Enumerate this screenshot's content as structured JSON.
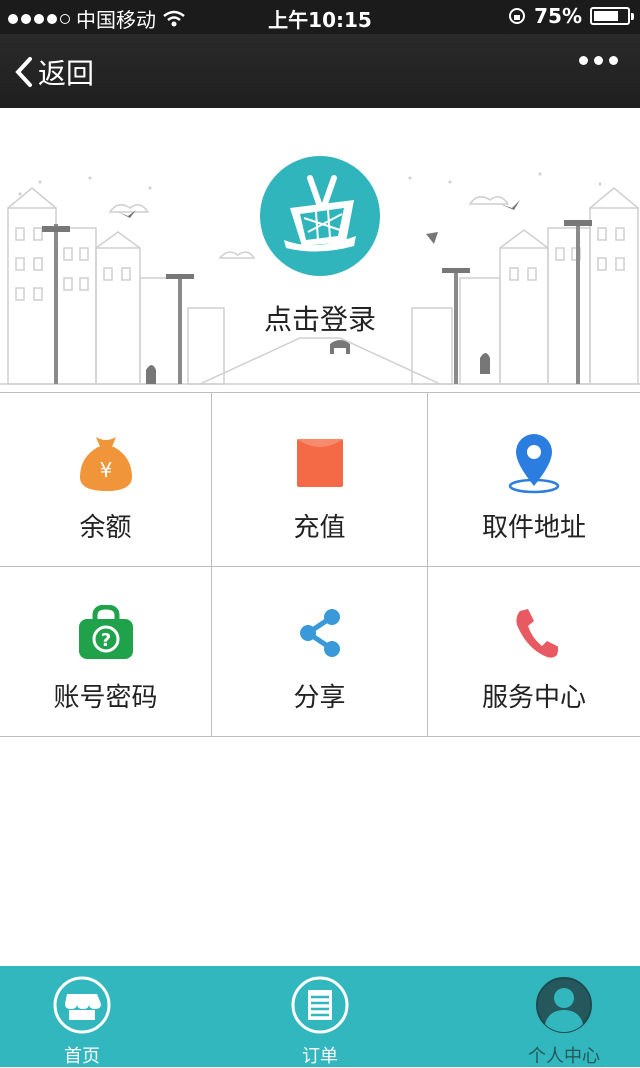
{
  "status_bar": {
    "carrier": "中国移动",
    "time": "上午10:15",
    "battery": "75%",
    "battery_level": 0.75
  },
  "nav": {
    "back_label": "返回",
    "more_icon": "more-dots-icon"
  },
  "banner": {
    "login_text": "点击登录",
    "avatar_icon": "shopping-basket-icon",
    "avatar_color": "#31b5bd"
  },
  "grid": [
    {
      "label": "余额",
      "icon": "money-bag-icon",
      "color": "#f0953a"
    },
    {
      "label": "充值",
      "icon": "red-envelope-icon",
      "color": "#f46a46"
    },
    {
      "label": "取件地址",
      "icon": "location-pin-icon",
      "color": "#2b7ee0"
    },
    {
      "label": "账号密码",
      "icon": "lock-bag-icon",
      "color": "#20a24a"
    },
    {
      "label": "分享",
      "icon": "share-icon",
      "color": "#3a9ad9"
    },
    {
      "label": "服务中心",
      "icon": "phone-icon",
      "color": "#e85a62"
    }
  ],
  "tabbar": {
    "background": "#33b7be",
    "items": [
      {
        "label": "首页",
        "icon": "store-icon"
      },
      {
        "label": "订单",
        "icon": "order-list-icon"
      },
      {
        "label": "个人中心",
        "icon": "user-icon"
      }
    ]
  }
}
